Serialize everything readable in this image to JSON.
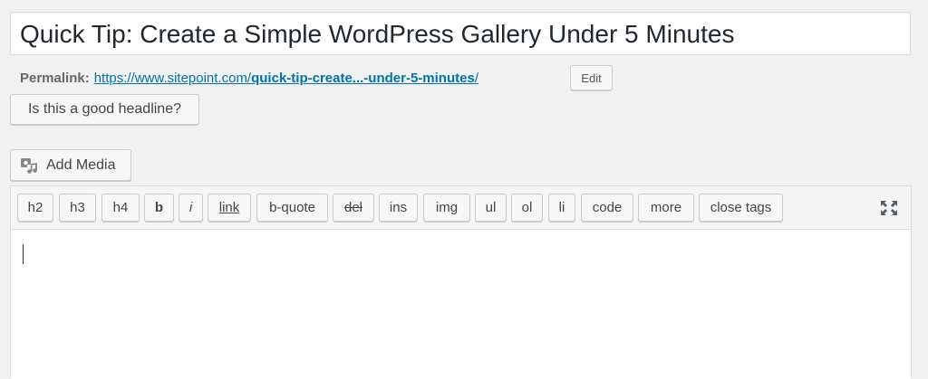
{
  "post": {
    "title": "Quick Tip: Create a Simple WordPress Gallery Under 5 Minutes"
  },
  "permalink": {
    "label": "Permalink:",
    "url_base": "https://www.sitepoint.com/",
    "url_slug": "quick-tip-create...-under-5-minutes",
    "url_end": "/",
    "edit_label": "Edit"
  },
  "headline_button": {
    "label": "Is this a good headline?"
  },
  "media": {
    "add_media_label": "Add Media",
    "icon": "media-icon"
  },
  "toolbar": {
    "buttons": [
      "h2",
      "h3",
      "h4",
      "b",
      "i",
      "link",
      "b-quote",
      "del",
      "ins",
      "img",
      "ul",
      "ol",
      "li",
      "code",
      "more",
      "close tags"
    ],
    "fullscreen_icon": "fullscreen-icon"
  },
  "colors": {
    "link": "#0073aa",
    "background": "#f1f1f1",
    "border": "#dddddd"
  }
}
